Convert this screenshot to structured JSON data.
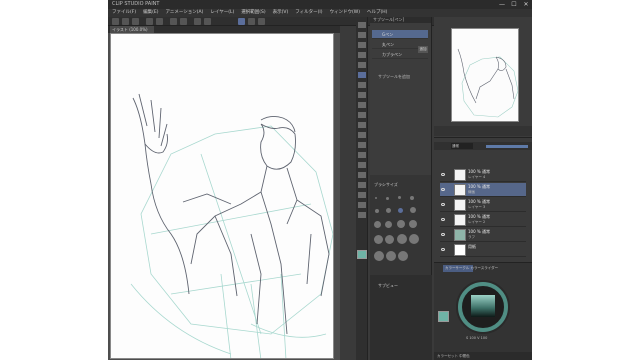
{
  "app": {
    "title": "CLIP STUDIO PAINT",
    "window_controls": [
      "—",
      "☐",
      "✕"
    ]
  },
  "menu": [
    "ファイル(F)",
    "編集(E)",
    "アニメーション(A)",
    "レイヤー(L)",
    "選択範囲(S)",
    "表示(V)",
    "フィルター(I)",
    "ウィンドウ(W)",
    "ヘルプ(H)"
  ],
  "canvas_tab": {
    "label": "イラスト (100.0%)"
  },
  "subtool": {
    "title": "サブツール[ペン]",
    "items": [
      {
        "label": "Gペン",
        "selected": true
      },
      {
        "label": "丸ペン",
        "selected": false
      },
      {
        "label": "カブラペン",
        "selected": false
      }
    ],
    "add_label": "サブツールを追加",
    "add_button": "追加"
  },
  "brush_size": {
    "label": "ブラシサイズ"
  },
  "subview": {
    "label": "サブビュー"
  },
  "layers": {
    "blend_mode": "通常",
    "opacity": 1.0,
    "rows": [
      {
        "name": "100 % 通常",
        "sub": "レイヤー 4",
        "selected": false
      },
      {
        "name": "100 % 通常",
        "sub": "線画",
        "selected": true
      },
      {
        "name": "100 % 通常",
        "sub": "レイヤー 3",
        "selected": false
      },
      {
        "name": "100 % 通常",
        "sub": "レイヤー 2",
        "selected": false
      },
      {
        "name": "100 % 通常",
        "sub": "ラフ",
        "selected": false
      },
      {
        "name": "用紙",
        "sub": "",
        "selected": false
      }
    ]
  },
  "color": {
    "tabs": "カラーサークル  カラースライダー",
    "current": "#6fb3a6",
    "readout": "S 100  V 100",
    "status": "カラーセット  中間色"
  }
}
